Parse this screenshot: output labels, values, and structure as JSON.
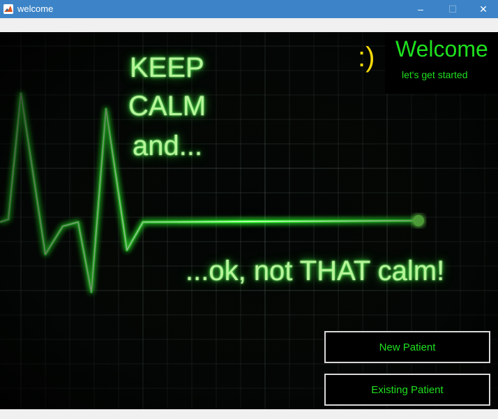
{
  "window": {
    "title": "welcome",
    "controls": {
      "minimize": "–",
      "maximize": "☐",
      "close": "✕"
    },
    "icon": "matlab-figure-icon"
  },
  "poster": {
    "line1": "KEEP",
    "line2": "CALM",
    "line3": "and...",
    "punchline": "...ok, not THAT calm!"
  },
  "welcome": {
    "smiley": ":)",
    "title": "Welcome",
    "subtitle": "let's get started"
  },
  "buttons": {
    "new_patient": "New Patient",
    "existing_patient": "Existing Patient"
  },
  "colors": {
    "titlebar": "#3c84c7",
    "accent_green": "#1fe01f",
    "smiley_yellow": "#f5d90a",
    "ecg_line": "#3dff3d"
  }
}
